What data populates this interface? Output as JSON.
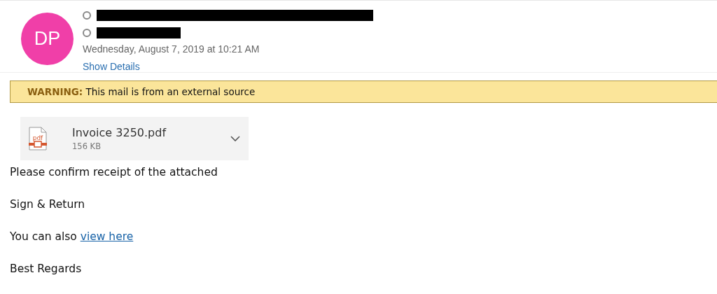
{
  "sender": {
    "initials": "DP",
    "color": "#f03fa8"
  },
  "recipients": [
    {
      "kind": "redacted"
    },
    {
      "kind": "redacted"
    }
  ],
  "date": "Wednesday, August 7, 2019 at 10:21 AM",
  "show_details": "Show Details",
  "warning": {
    "label": "WARNING:",
    "text": "This mail is from an external source"
  },
  "attachment": {
    "icon_label": "pdf",
    "name": "Invoice 3250.pdf",
    "size": "156 KB"
  },
  "body": [
    {
      "kind": "text",
      "text": "Please confirm receipt of the attached"
    },
    {
      "kind": "text",
      "text": "Sign & Return"
    },
    {
      "kind": "link",
      "text": "You can also",
      "link": "view here"
    },
    {
      "kind": "text",
      "text": "Best Regards"
    }
  ]
}
